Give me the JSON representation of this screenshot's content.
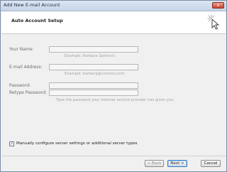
{
  "window": {
    "title": "Add New E-mail Account",
    "close_glyph": "x"
  },
  "header": {
    "title": "Auto Account Setup",
    "icon": "cursor-click-icon"
  },
  "form": {
    "name_label": "Your Name:",
    "name_value": "",
    "name_hint": "Example: Barbara Sankovic",
    "email_label": "E-mail Address:",
    "email_value": "",
    "email_hint": "Example: barbara@contoso.com",
    "password_label": "Password:",
    "password_value": "",
    "retype_label": "Retype Password:",
    "retype_value": "",
    "password_hint": "Type the password your Internet service provider has given you."
  },
  "manual_config": {
    "label": "Manually configure server settings or additional server types",
    "checked": true,
    "check_glyph": "✓"
  },
  "buttons": {
    "back": "< Back",
    "next": "Next >",
    "cancel": "Cancel"
  }
}
